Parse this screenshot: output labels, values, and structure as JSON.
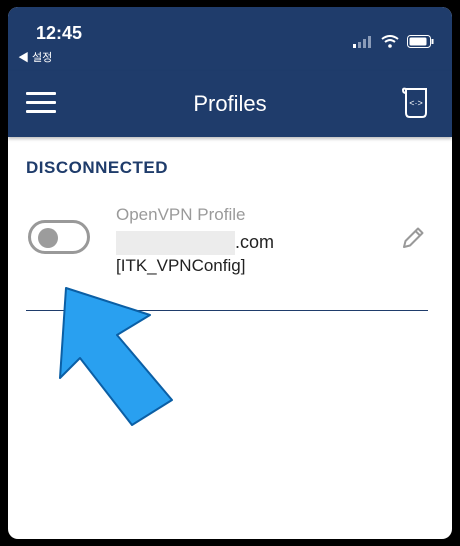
{
  "statusbar": {
    "time": "12:45",
    "back_label": "◀ 설정"
  },
  "navbar": {
    "title": "Profiles"
  },
  "section": {
    "label": "DISCONNECTED"
  },
  "profile": {
    "type": "OpenVPN Profile",
    "server_suffix": ".com",
    "name": "[ITK_VPNConfig]",
    "connected": false
  },
  "colors": {
    "brand": "#1f3c6b",
    "arrow": "#29a0f0"
  }
}
